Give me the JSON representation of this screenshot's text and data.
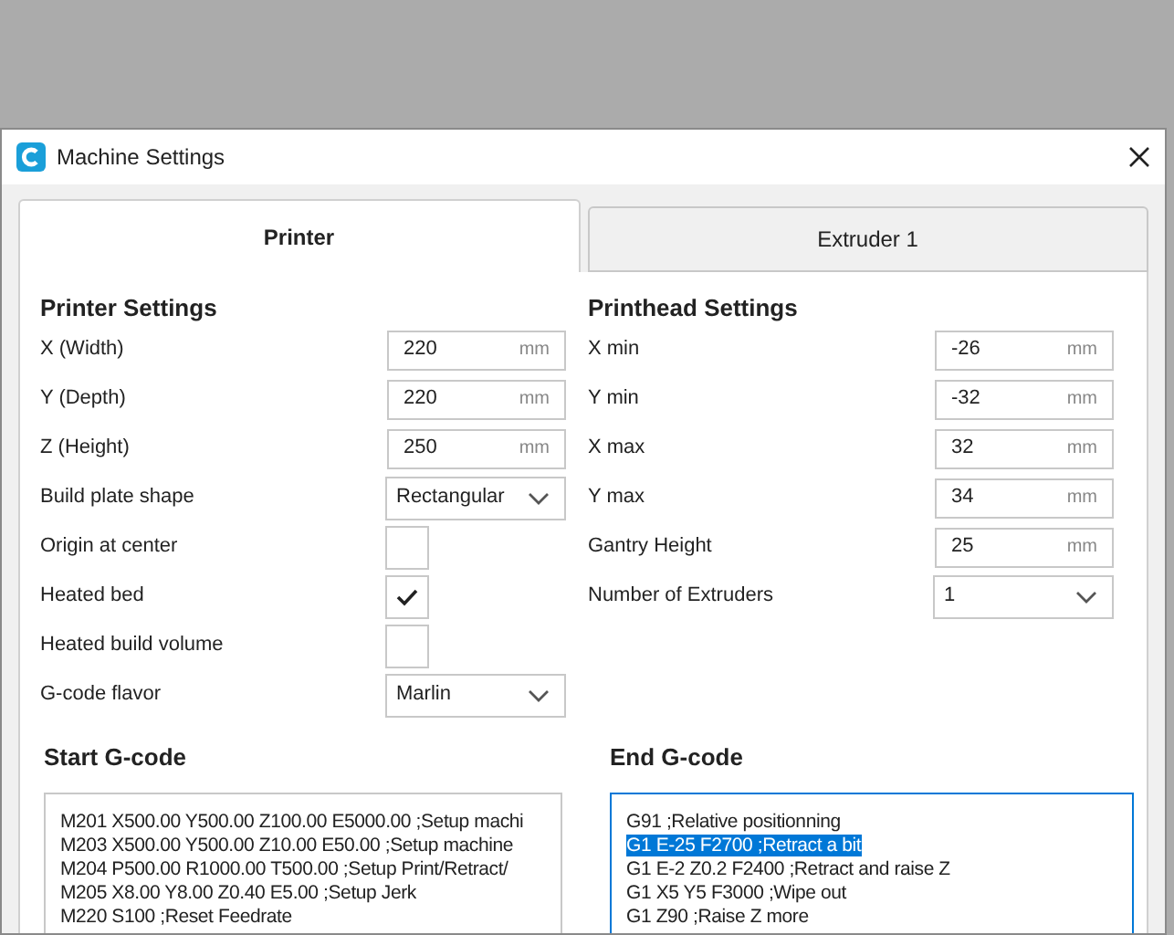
{
  "window": {
    "title": "Machine Settings"
  },
  "tabs": [
    {
      "label": "Printer",
      "selected": true
    },
    {
      "label": "Extruder 1",
      "selected": false
    }
  ],
  "printer_settings": {
    "heading": "Printer Settings",
    "rows": [
      {
        "kind": "number",
        "label": "X (Width)",
        "value": "220",
        "unit": "mm"
      },
      {
        "kind": "number",
        "label": "Y (Depth)",
        "value": "220",
        "unit": "mm"
      },
      {
        "kind": "number",
        "label": "Z (Height)",
        "value": "250",
        "unit": "mm"
      },
      {
        "kind": "dropdown",
        "label": "Build plate shape",
        "value": "Rectangular"
      },
      {
        "kind": "checkbox",
        "label": "Origin at center",
        "checked": false
      },
      {
        "kind": "checkbox",
        "label": "Heated bed",
        "checked": true
      },
      {
        "kind": "checkbox",
        "label": "Heated build volume",
        "checked": false
      },
      {
        "kind": "dropdown",
        "label": "G-code flavor",
        "value": "Marlin"
      }
    ]
  },
  "printhead_settings": {
    "heading": "Printhead Settings",
    "rows": [
      {
        "kind": "number",
        "label": "X min",
        "value": "-26",
        "unit": "mm"
      },
      {
        "kind": "number",
        "label": "Y min",
        "value": "-32",
        "unit": "mm"
      },
      {
        "kind": "number",
        "label": "X max",
        "value": "32",
        "unit": "mm"
      },
      {
        "kind": "number",
        "label": "Y max",
        "value": "34",
        "unit": "mm"
      },
      {
        "kind": "number",
        "label": "Gantry Height",
        "value": "25",
        "unit": "mm"
      },
      {
        "kind": "dropdown",
        "label": "Number of Extruders",
        "value": "1"
      }
    ]
  },
  "start_gcode": {
    "heading": "Start G-code",
    "focused": false,
    "lines": [
      {
        "text": "M201 X500.00 Y500.00 Z100.00 E5000.00 ;Setup machi",
        "selected": false
      },
      {
        "text": "M203 X500.00 Y500.00 Z10.00 E50.00 ;Setup machine",
        "selected": false
      },
      {
        "text": "M204 P500.00 R1000.00 T500.00 ;Setup Print/Retract/",
        "selected": false
      },
      {
        "text": "M205 X8.00 Y8.00 Z0.40 E5.00 ;Setup Jerk",
        "selected": false
      },
      {
        "text": "M220 S100 ;Reset Feedrate",
        "selected": false
      }
    ]
  },
  "end_gcode": {
    "heading": "End G-code",
    "focused": true,
    "lines": [
      {
        "text": "G91 ;Relative positionning",
        "selected": false
      },
      {
        "text": "G1 E-25 F2700 ;Retract a bit",
        "selected": true
      },
      {
        "text": "G1 E-2 Z0.2 F2400 ;Retract and raise Z",
        "selected": false
      },
      {
        "text": "G1 X5 Y5 F3000 ;Wipe out",
        "selected": false
      },
      {
        "text": "G1 Z90 ;Raise Z more",
        "selected": false
      }
    ]
  }
}
